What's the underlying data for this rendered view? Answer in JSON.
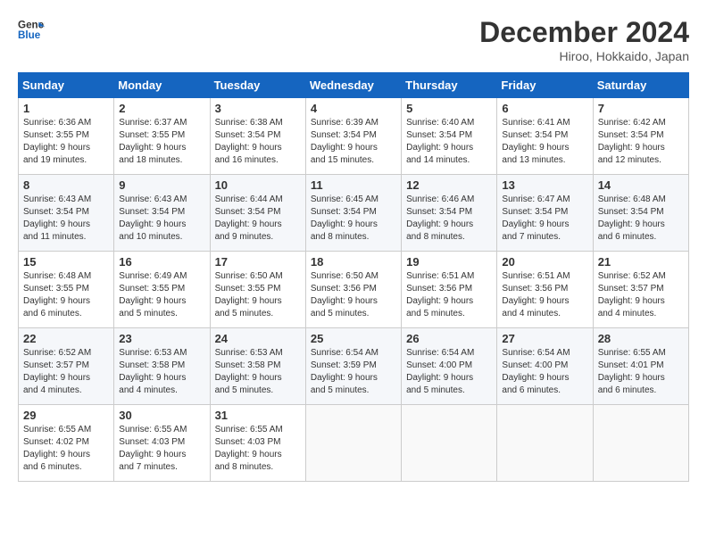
{
  "header": {
    "logo_line1": "General",
    "logo_line2": "Blue",
    "month_title": "December 2024",
    "subtitle": "Hiroo, Hokkaido, Japan"
  },
  "days_of_week": [
    "Sunday",
    "Monday",
    "Tuesday",
    "Wednesday",
    "Thursday",
    "Friday",
    "Saturday"
  ],
  "weeks": [
    [
      {
        "day": "1",
        "info": "Sunrise: 6:36 AM\nSunset: 3:55 PM\nDaylight: 9 hours\nand 19 minutes."
      },
      {
        "day": "2",
        "info": "Sunrise: 6:37 AM\nSunset: 3:55 PM\nDaylight: 9 hours\nand 18 minutes."
      },
      {
        "day": "3",
        "info": "Sunrise: 6:38 AM\nSunset: 3:54 PM\nDaylight: 9 hours\nand 16 minutes."
      },
      {
        "day": "4",
        "info": "Sunrise: 6:39 AM\nSunset: 3:54 PM\nDaylight: 9 hours\nand 15 minutes."
      },
      {
        "day": "5",
        "info": "Sunrise: 6:40 AM\nSunset: 3:54 PM\nDaylight: 9 hours\nand 14 minutes."
      },
      {
        "day": "6",
        "info": "Sunrise: 6:41 AM\nSunset: 3:54 PM\nDaylight: 9 hours\nand 13 minutes."
      },
      {
        "day": "7",
        "info": "Sunrise: 6:42 AM\nSunset: 3:54 PM\nDaylight: 9 hours\nand 12 minutes."
      }
    ],
    [
      {
        "day": "8",
        "info": "Sunrise: 6:43 AM\nSunset: 3:54 PM\nDaylight: 9 hours\nand 11 minutes."
      },
      {
        "day": "9",
        "info": "Sunrise: 6:43 AM\nSunset: 3:54 PM\nDaylight: 9 hours\nand 10 minutes."
      },
      {
        "day": "10",
        "info": "Sunrise: 6:44 AM\nSunset: 3:54 PM\nDaylight: 9 hours\nand 9 minutes."
      },
      {
        "day": "11",
        "info": "Sunrise: 6:45 AM\nSunset: 3:54 PM\nDaylight: 9 hours\nand 8 minutes."
      },
      {
        "day": "12",
        "info": "Sunrise: 6:46 AM\nSunset: 3:54 PM\nDaylight: 9 hours\nand 8 minutes."
      },
      {
        "day": "13",
        "info": "Sunrise: 6:47 AM\nSunset: 3:54 PM\nDaylight: 9 hours\nand 7 minutes."
      },
      {
        "day": "14",
        "info": "Sunrise: 6:48 AM\nSunset: 3:54 PM\nDaylight: 9 hours\nand 6 minutes."
      }
    ],
    [
      {
        "day": "15",
        "info": "Sunrise: 6:48 AM\nSunset: 3:55 PM\nDaylight: 9 hours\nand 6 minutes."
      },
      {
        "day": "16",
        "info": "Sunrise: 6:49 AM\nSunset: 3:55 PM\nDaylight: 9 hours\nand 5 minutes."
      },
      {
        "day": "17",
        "info": "Sunrise: 6:50 AM\nSunset: 3:55 PM\nDaylight: 9 hours\nand 5 minutes."
      },
      {
        "day": "18",
        "info": "Sunrise: 6:50 AM\nSunset: 3:56 PM\nDaylight: 9 hours\nand 5 minutes."
      },
      {
        "day": "19",
        "info": "Sunrise: 6:51 AM\nSunset: 3:56 PM\nDaylight: 9 hours\nand 5 minutes."
      },
      {
        "day": "20",
        "info": "Sunrise: 6:51 AM\nSunset: 3:56 PM\nDaylight: 9 hours\nand 4 minutes."
      },
      {
        "day": "21",
        "info": "Sunrise: 6:52 AM\nSunset: 3:57 PM\nDaylight: 9 hours\nand 4 minutes."
      }
    ],
    [
      {
        "day": "22",
        "info": "Sunrise: 6:52 AM\nSunset: 3:57 PM\nDaylight: 9 hours\nand 4 minutes."
      },
      {
        "day": "23",
        "info": "Sunrise: 6:53 AM\nSunset: 3:58 PM\nDaylight: 9 hours\nand 4 minutes."
      },
      {
        "day": "24",
        "info": "Sunrise: 6:53 AM\nSunset: 3:58 PM\nDaylight: 9 hours\nand 5 minutes."
      },
      {
        "day": "25",
        "info": "Sunrise: 6:54 AM\nSunset: 3:59 PM\nDaylight: 9 hours\nand 5 minutes."
      },
      {
        "day": "26",
        "info": "Sunrise: 6:54 AM\nSunset: 4:00 PM\nDaylight: 9 hours\nand 5 minutes."
      },
      {
        "day": "27",
        "info": "Sunrise: 6:54 AM\nSunset: 4:00 PM\nDaylight: 9 hours\nand 6 minutes."
      },
      {
        "day": "28",
        "info": "Sunrise: 6:55 AM\nSunset: 4:01 PM\nDaylight: 9 hours\nand 6 minutes."
      }
    ],
    [
      {
        "day": "29",
        "info": "Sunrise: 6:55 AM\nSunset: 4:02 PM\nDaylight: 9 hours\nand 6 minutes."
      },
      {
        "day": "30",
        "info": "Sunrise: 6:55 AM\nSunset: 4:03 PM\nDaylight: 9 hours\nand 7 minutes."
      },
      {
        "day": "31",
        "info": "Sunrise: 6:55 AM\nSunset: 4:03 PM\nDaylight: 9 hours\nand 8 minutes."
      },
      null,
      null,
      null,
      null
    ]
  ]
}
